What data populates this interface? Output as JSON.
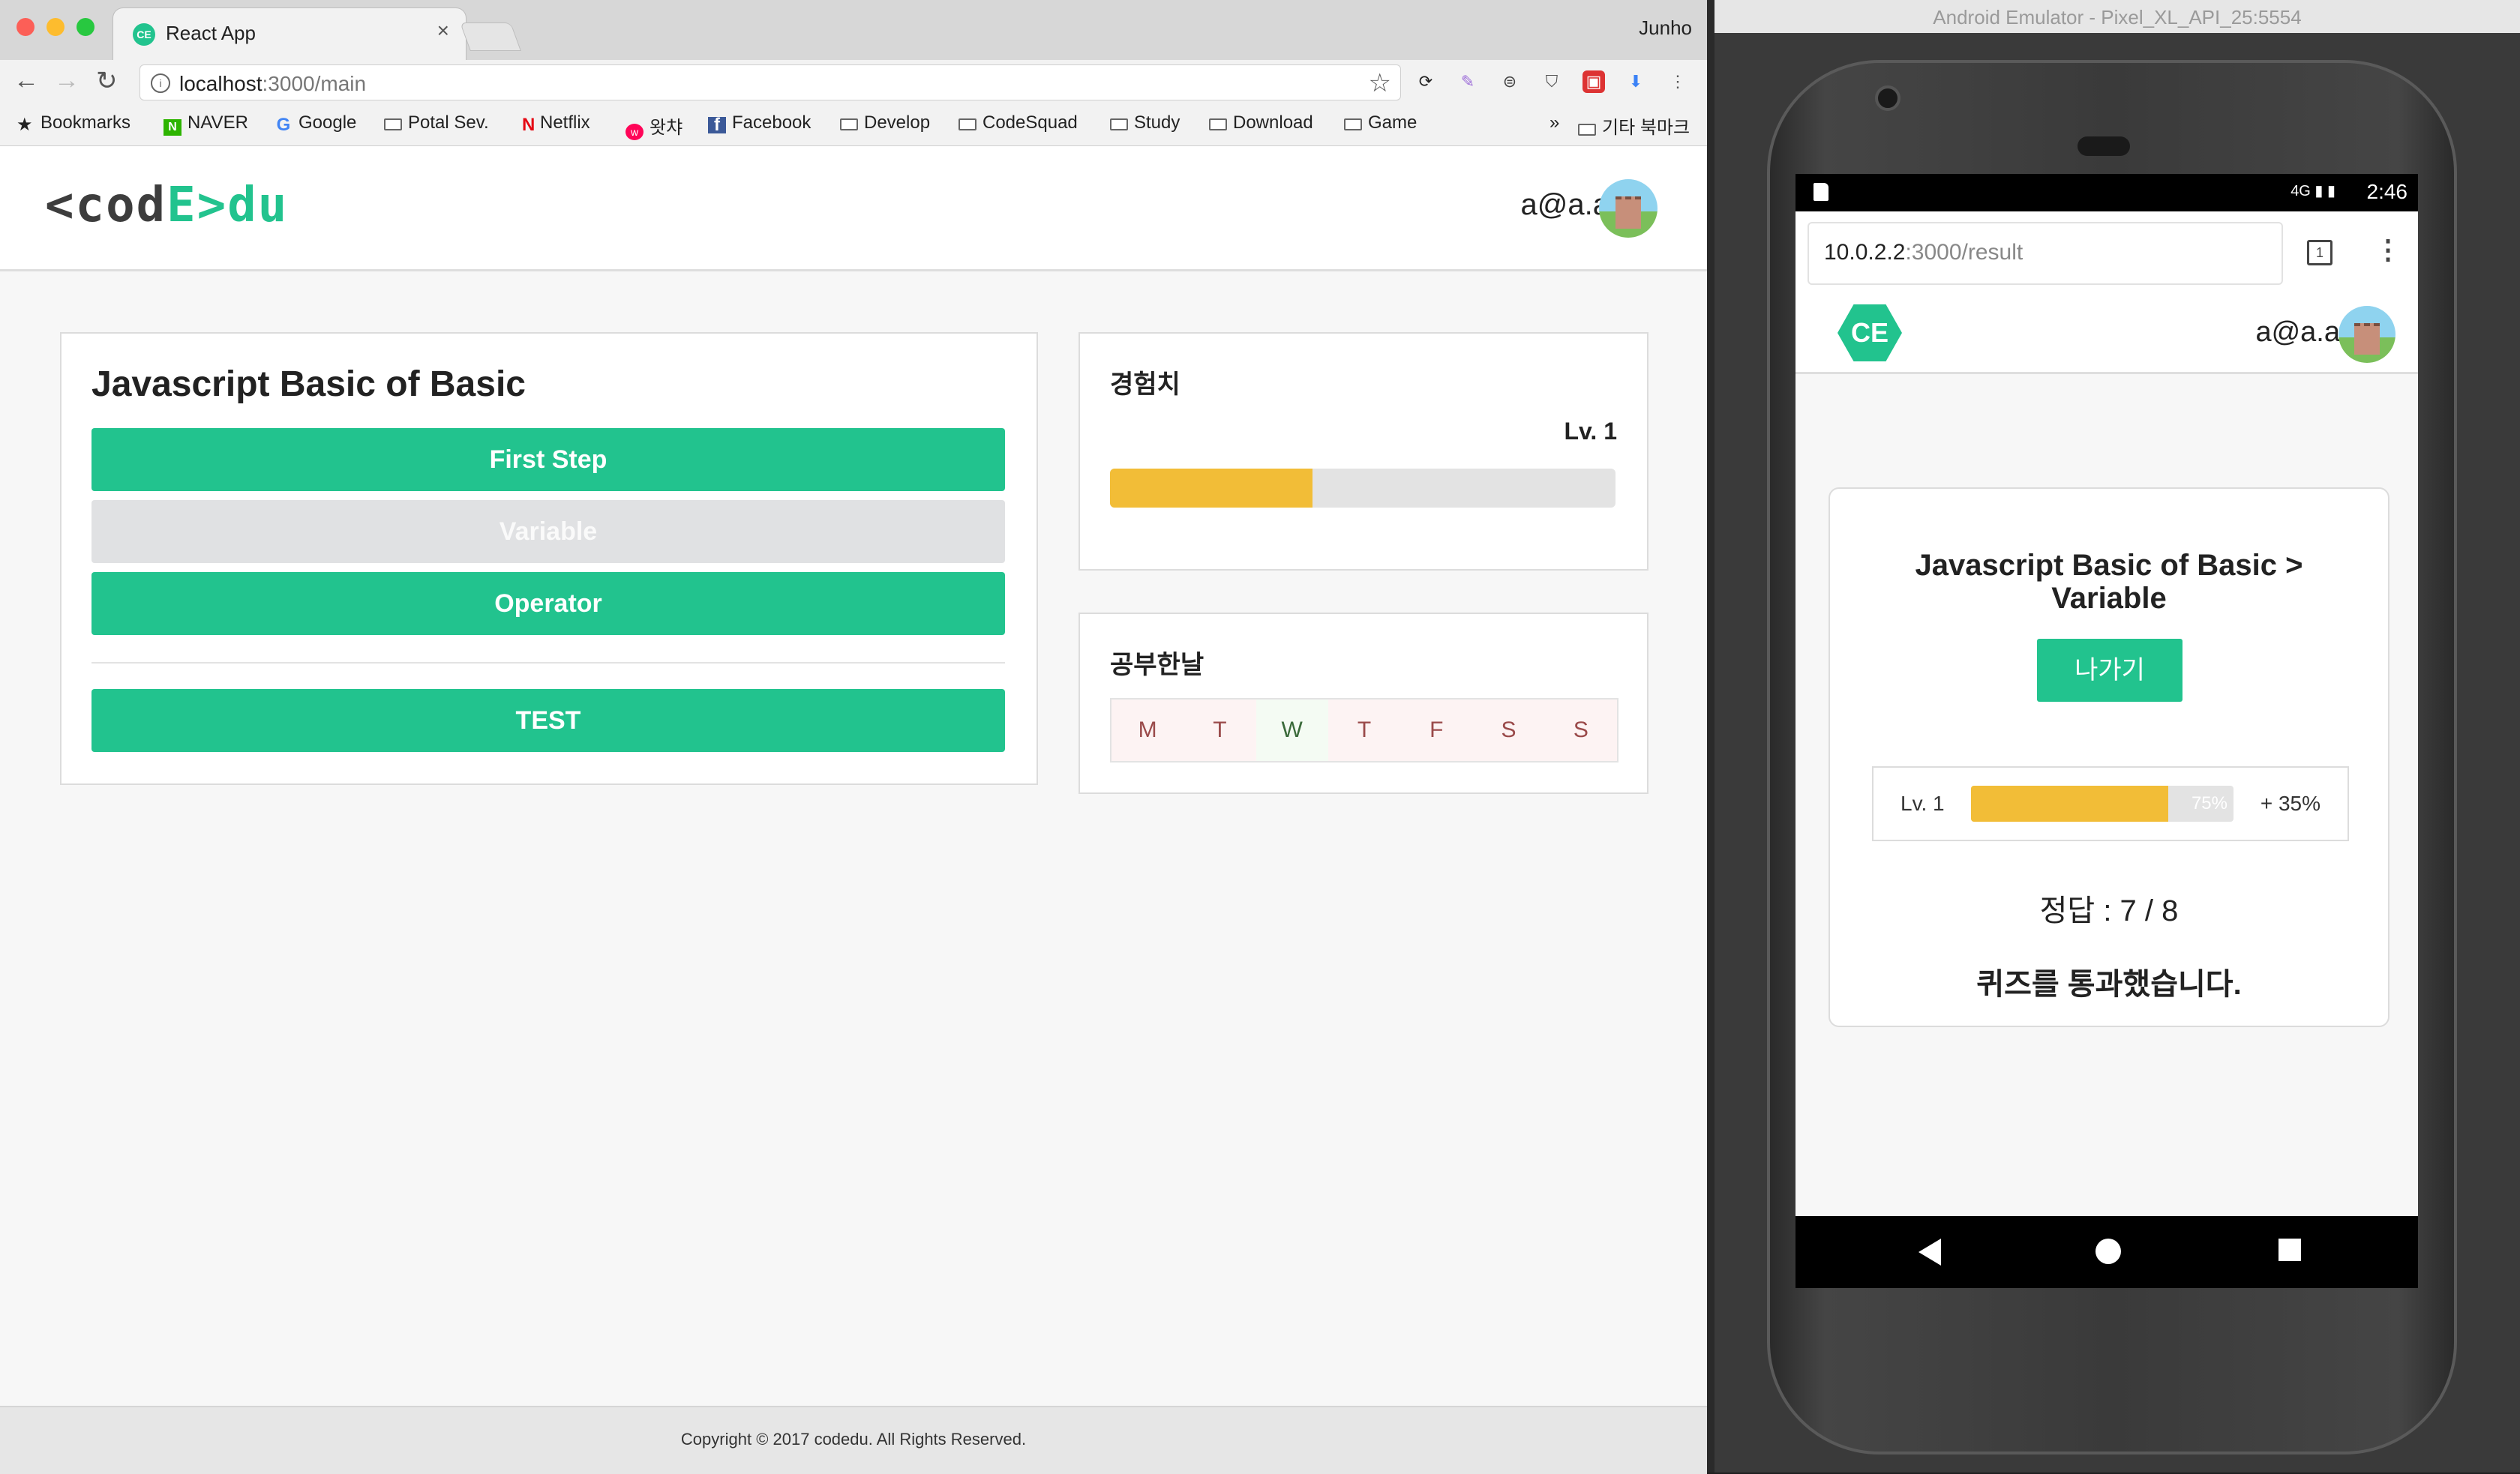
{
  "browser": {
    "tab_title": "React App",
    "tab_favicon": "CE",
    "tab_close": "×",
    "profile_name": "Junho",
    "url_host": "localhost",
    "url_path": ":3000/main",
    "bookmarks": [
      {
        "label": "Bookmarks",
        "icon": "star-icon"
      },
      {
        "label": "NAVER",
        "icon": "naver-icon"
      },
      {
        "label": "Google",
        "icon": "google-icon"
      },
      {
        "label": "Potal Sev.",
        "icon": "folder-icon"
      },
      {
        "label": "Netflix",
        "icon": "netflix-icon"
      },
      {
        "label": "왓챠",
        "icon": "watcha-icon"
      },
      {
        "label": "Facebook",
        "icon": "facebook-icon"
      },
      {
        "label": "Develop",
        "icon": "folder-icon"
      },
      {
        "label": "CodeSquad",
        "icon": "folder-icon"
      },
      {
        "label": "Study",
        "icon": "folder-icon"
      },
      {
        "label": "Download",
        "icon": "folder-icon"
      },
      {
        "label": "Game",
        "icon": "folder-icon"
      }
    ],
    "bookmarks_overflow": "»",
    "other_bookmarks": "기타 북마크"
  },
  "app": {
    "logo": {
      "open": "<",
      "cod": "cod",
      "e_open": "E>",
      "du": "du"
    },
    "user_email": "a@a.a",
    "course": {
      "title": "Javascript Basic of Basic",
      "steps": [
        {
          "label": "First Step",
          "state": "enabled"
        },
        {
          "label": "Variable",
          "state": "disabled"
        },
        {
          "label": "Operator",
          "state": "enabled"
        }
      ],
      "test_label": "TEST"
    },
    "experience": {
      "title": "경험치",
      "level": "Lv. 1",
      "progress": 0.4
    },
    "study_days": {
      "title": "공부한날",
      "days": [
        {
          "label": "M",
          "done": false
        },
        {
          "label": "T",
          "done": false
        },
        {
          "label": "W",
          "done": true
        },
        {
          "label": "T",
          "done": false
        },
        {
          "label": "F",
          "done": false
        },
        {
          "label": "S",
          "done": false
        },
        {
          "label": "S",
          "done": false
        }
      ]
    },
    "footer": "Copyright © 2017 codedu. All Rights Reserved."
  },
  "emulator": {
    "title": "Android Emulator - Pixel_XL_API_25:5554",
    "status_time": "2:46",
    "status_network": "4G",
    "url_host": "10.0.2.2",
    "url_path": ":3000/result",
    "tab_count": "1",
    "logo": "CE",
    "user_email": "a@a.a",
    "result": {
      "title_line1": "Javascript Basic of Basic >",
      "title_line2": "Variable",
      "exit_label": "나가기",
      "level": "Lv. 1",
      "progress_label": "75%",
      "progress": 0.75,
      "gain": "+ 35%",
      "score": "정답 : 7 / 8",
      "message": "퀴즈를 통과했습니다."
    }
  },
  "colors": {
    "accent": "#22c38e",
    "progress": "#f2bd37",
    "disabled": "#e0e1e3"
  }
}
